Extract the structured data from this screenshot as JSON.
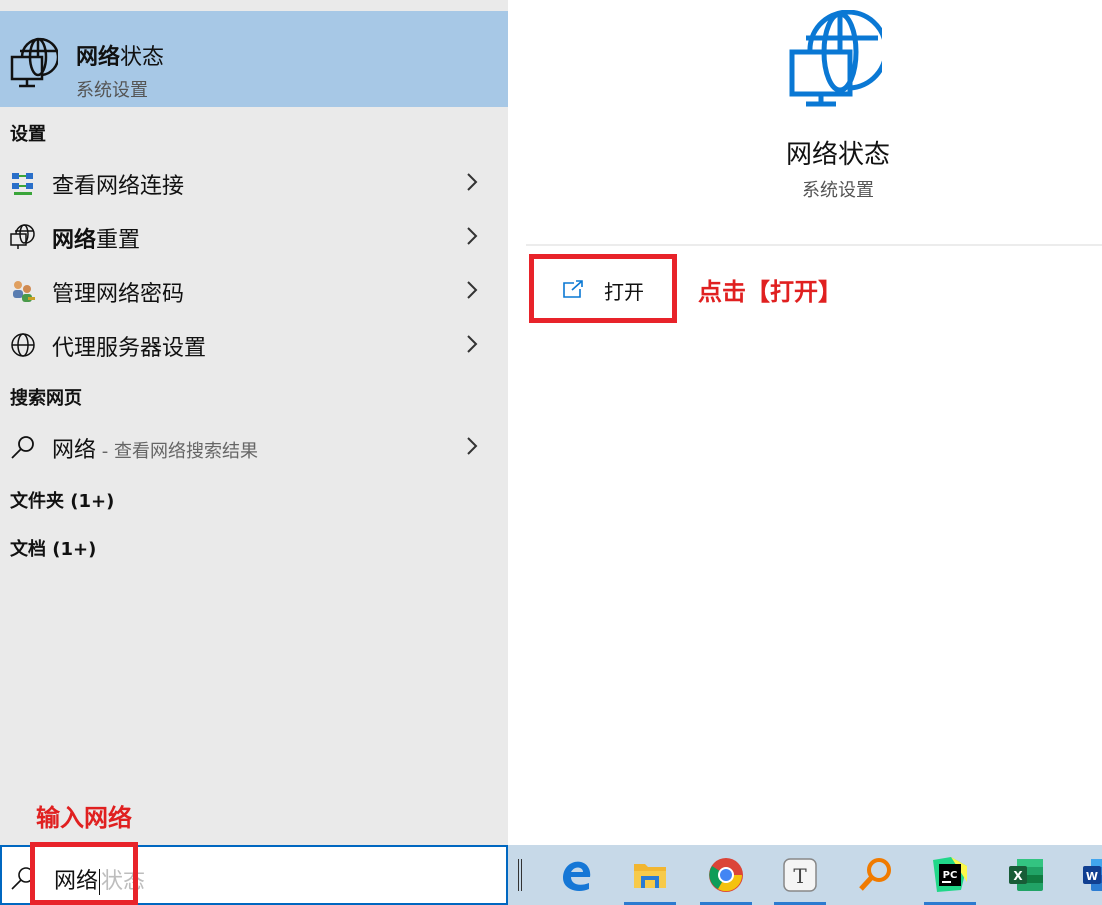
{
  "best_match": {
    "title_bold": "网络",
    "title_rest": "状态",
    "subtitle": "系统设置"
  },
  "sections": {
    "settings": "设置",
    "web": "搜索网页",
    "folders": "文件夹 (1+)",
    "documents": "文档 (1+)"
  },
  "settings_results": [
    {
      "icon": "network-connections-icon",
      "bold": "",
      "text": "查看网络连接"
    },
    {
      "icon": "globe-monitor-icon",
      "bold": "网络",
      "text": "重置"
    },
    {
      "icon": "users-key-icon",
      "bold": "",
      "text": "管理网络密码"
    },
    {
      "icon": "globe-icon",
      "bold": "",
      "text": "代理服务器设置"
    }
  ],
  "web_result": {
    "icon": "search-icon",
    "text": "网络",
    "sub": " - 查看网络搜索结果"
  },
  "preview": {
    "title": "网络状态",
    "subtitle": "系统设置",
    "open_label": "打开"
  },
  "annotations": {
    "click_open": "点击【打开】",
    "type_network": "输入网络"
  },
  "search": {
    "typed": "网络",
    "suggestion": "状态"
  },
  "taskbar": {
    "items": [
      "edge-icon",
      "file-explorer-icon",
      "chrome-icon",
      "typora-icon",
      "search-tool-icon",
      "pycharm-icon",
      "excel-icon",
      "word-icon"
    ],
    "pycharm_label": "PC",
    "excel_label": "X",
    "word_label": "W",
    "typora_label": "T"
  },
  "colors": {
    "accent": "#0067c0",
    "highlight_red": "#e8232a",
    "best_match_bg": "#a7c8e6"
  }
}
